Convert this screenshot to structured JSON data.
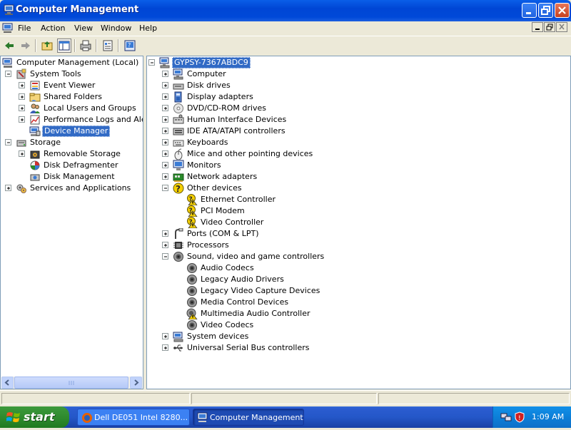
{
  "window": {
    "title": "Computer Management"
  },
  "menu": {
    "items": [
      "File",
      "Action",
      "View",
      "Window",
      "Help"
    ]
  },
  "toolbar": {
    "buttons": [
      "back",
      "forward",
      "up-one-level",
      "show-hide-console-tree",
      "print",
      "properties",
      "help"
    ]
  },
  "left_tree": [
    {
      "label": "Computer Management (Local)",
      "icon": "computer-management-icon",
      "level": 0,
      "expander": "none"
    },
    {
      "label": "System Tools",
      "icon": "system-tools-icon",
      "level": 1,
      "expander": "minus"
    },
    {
      "label": "Event Viewer",
      "icon": "event-viewer-icon",
      "level": 2,
      "expander": "plus"
    },
    {
      "label": "Shared Folders",
      "icon": "shared-folders-icon",
      "level": 2,
      "expander": "plus"
    },
    {
      "label": "Local Users and Groups",
      "icon": "users-icon",
      "level": 2,
      "expander": "plus"
    },
    {
      "label": "Performance Logs and Alerts",
      "icon": "performance-icon",
      "level": 2,
      "expander": "plus"
    },
    {
      "label": "Device Manager",
      "icon": "device-manager-icon",
      "level": 2,
      "expander": "none",
      "selected": true
    },
    {
      "label": "Storage",
      "icon": "storage-icon",
      "level": 1,
      "expander": "minus"
    },
    {
      "label": "Removable Storage",
      "icon": "removable-storage-icon",
      "level": 2,
      "expander": "plus"
    },
    {
      "label": "Disk Defragmenter",
      "icon": "defrag-icon",
      "level": 2,
      "expander": "none"
    },
    {
      "label": "Disk Management",
      "icon": "disk-management-icon",
      "level": 2,
      "expander": "none"
    },
    {
      "label": "Services and Applications",
      "icon": "services-icon",
      "level": 1,
      "expander": "plus"
    }
  ],
  "right_tree": [
    {
      "label": "GYPSY-7367ABDC9",
      "icon": "computer-icon",
      "level": 0,
      "expander": "minus",
      "selected": true
    },
    {
      "label": "Computer",
      "icon": "computer-icon",
      "level": 1,
      "expander": "plus"
    },
    {
      "label": "Disk drives",
      "icon": "disk-drive-icon",
      "level": 1,
      "expander": "plus"
    },
    {
      "label": "Display adapters",
      "icon": "display-adapter-icon",
      "level": 1,
      "expander": "plus"
    },
    {
      "label": "DVD/CD-ROM drives",
      "icon": "cdrom-icon",
      "level": 1,
      "expander": "plus"
    },
    {
      "label": "Human Interface Devices",
      "icon": "hid-icon",
      "level": 1,
      "expander": "plus"
    },
    {
      "label": "IDE ATA/ATAPI controllers",
      "icon": "ide-controller-icon",
      "level": 1,
      "expander": "plus"
    },
    {
      "label": "Keyboards",
      "icon": "keyboard-icon",
      "level": 1,
      "expander": "plus"
    },
    {
      "label": "Mice and other pointing devices",
      "icon": "mouse-icon",
      "level": 1,
      "expander": "plus"
    },
    {
      "label": "Monitors",
      "icon": "monitor-icon",
      "level": 1,
      "expander": "plus"
    },
    {
      "label": "Network adapters",
      "icon": "network-adapter-icon",
      "level": 1,
      "expander": "plus"
    },
    {
      "label": "Other devices",
      "icon": "unknown-device-icon",
      "level": 1,
      "expander": "minus"
    },
    {
      "label": "Ethernet Controller",
      "icon": "warning-device-icon",
      "level": 2,
      "expander": "none"
    },
    {
      "label": "PCI Modem",
      "icon": "warning-device-icon",
      "level": 2,
      "expander": "none"
    },
    {
      "label": "Video Controller",
      "icon": "warning-device-icon",
      "level": 2,
      "expander": "none"
    },
    {
      "label": "Ports (COM & LPT)",
      "icon": "port-icon",
      "level": 1,
      "expander": "plus"
    },
    {
      "label": "Processors",
      "icon": "processor-icon",
      "level": 1,
      "expander": "plus"
    },
    {
      "label": "Sound, video and game controllers",
      "icon": "sound-icon",
      "level": 1,
      "expander": "minus"
    },
    {
      "label": "Audio Codecs",
      "icon": "sound-icon",
      "level": 2,
      "expander": "none"
    },
    {
      "label": "Legacy Audio Drivers",
      "icon": "sound-icon",
      "level": 2,
      "expander": "none"
    },
    {
      "label": "Legacy Video Capture Devices",
      "icon": "sound-icon",
      "level": 2,
      "expander": "none"
    },
    {
      "label": "Media Control Devices",
      "icon": "sound-icon",
      "level": 2,
      "expander": "none"
    },
    {
      "label": "Multimedia Audio Controller",
      "icon": "sound-warning-icon",
      "level": 2,
      "expander": "none"
    },
    {
      "label": "Video Codecs",
      "icon": "sound-icon",
      "level": 2,
      "expander": "none"
    },
    {
      "label": "System devices",
      "icon": "system-device-icon",
      "level": 1,
      "expander": "plus"
    },
    {
      "label": "Universal Serial Bus controllers",
      "icon": "usb-icon",
      "level": 1,
      "expander": "plus"
    }
  ],
  "taskbar": {
    "start_label": "start",
    "tasks": [
      {
        "label": "Dell DE051 Intel 8280...",
        "icon": "firefox-icon",
        "active": false
      },
      {
        "label": "Computer Management",
        "icon": "computer-management-icon",
        "active": true
      }
    ],
    "clock": "1:09 AM"
  },
  "colors": {
    "titlebar": "#0054e3",
    "selection": "#316ac5",
    "warning": "#f5d000",
    "start": "#3c9a3c"
  }
}
